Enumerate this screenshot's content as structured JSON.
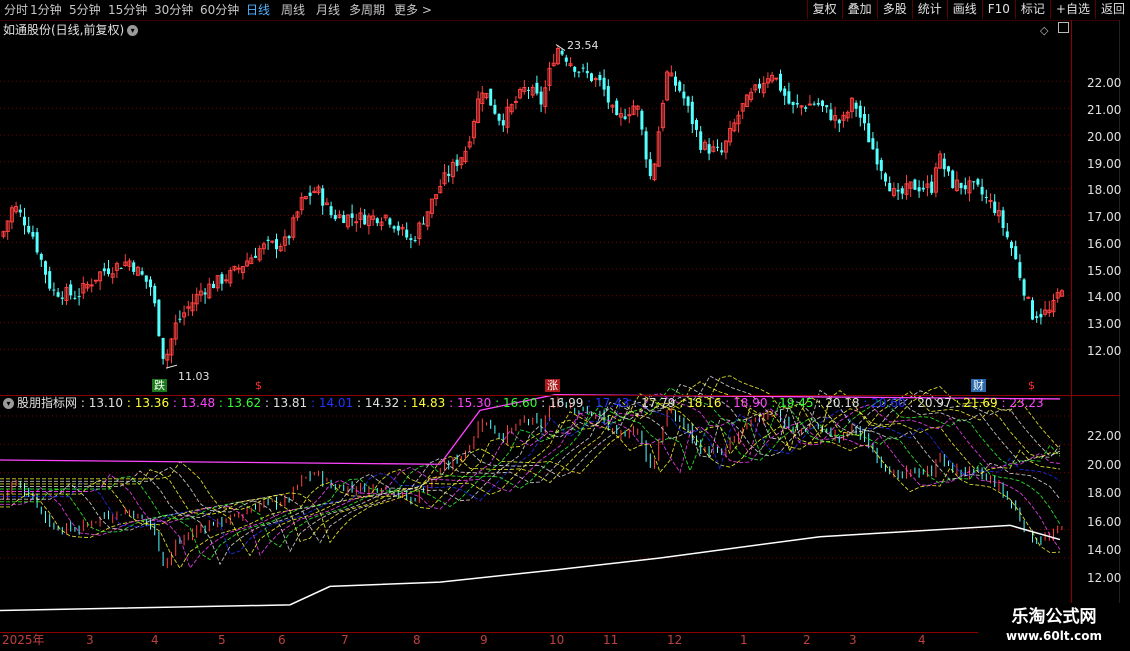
{
  "toolbar": {
    "periods": [
      "分时",
      "1分钟",
      "5分钟",
      "15分钟",
      "30分钟",
      "60分钟",
      "日线",
      "周线",
      "月线",
      "多周期",
      "更多 >"
    ],
    "active_period": "日线",
    "tools": [
      "复权",
      "叠加",
      "多股",
      "统计",
      "画线",
      "F10",
      "标记",
      "+自选",
      "返回"
    ]
  },
  "stock": {
    "title": "如通股份(日线,前复权)",
    "high_label": "23.54",
    "low_label": "11.03"
  },
  "price_axis": [
    "22.00",
    "21.00",
    "20.00",
    "19.00",
    "18.00",
    "17.00",
    "16.00",
    "15.00",
    "14.00",
    "13.00",
    "12.00"
  ],
  "indicator": {
    "name": "股朋指标网",
    "values": [
      {
        "v": "13.10",
        "color": "#e0e0e0"
      },
      {
        "v": "13.36",
        "color": "#ffff33"
      },
      {
        "v": "13.48",
        "color": "#ff44ff"
      },
      {
        "v": "13.62",
        "color": "#33ff33"
      },
      {
        "v": "13.81",
        "color": "#e0e0e0"
      },
      {
        "v": "14.01",
        "color": "#2233ff"
      },
      {
        "v": "14.32",
        "color": "#e0e0e0"
      },
      {
        "v": "14.83",
        "color": "#ffff33"
      },
      {
        "v": "15.30",
        "color": "#ff44ff"
      },
      {
        "v": "16.60",
        "color": "#33ff33"
      },
      {
        "v": "16.99",
        "color": "#e0e0e0"
      },
      {
        "v": "17.43",
        "color": "#2233ff"
      },
      {
        "v": "17.79",
        "color": "#e0e0e0"
      },
      {
        "v": "18.16",
        "color": "#ffff33"
      },
      {
        "v": "18.90",
        "color": "#ff44ff"
      },
      {
        "v": "19.45",
        "color": "#33ff33"
      },
      {
        "v": "20.18",
        "color": "#e0e0e0"
      },
      {
        "v": "20.60",
        "color": "#2233ff"
      },
      {
        "v": "20.97",
        "color": "#e0e0e0"
      },
      {
        "v": "21.69",
        "color": "#ffff33"
      },
      {
        "v": "23.23",
        "color": "#ff44ff"
      }
    ]
  },
  "indicator_axis": [
    "22.00",
    "20.00",
    "18.00",
    "16.00",
    "14.00",
    "12.00"
  ],
  "markers": [
    {
      "text": "跌",
      "bg": "#1a7a1a",
      "color": "#ffffff"
    },
    {
      "text": "$",
      "bg": "transparent",
      "color": "#ff3030"
    },
    {
      "text": "涨",
      "bg": "#aa1a1a",
      "color": "#ffffff"
    },
    {
      "text": "财",
      "bg": "#2a6aaa",
      "color": "#ffffff"
    },
    {
      "text": "$",
      "bg": "transparent",
      "color": "#ff3030"
    }
  ],
  "months": [
    "2025年",
    "3",
    "4",
    "5",
    "6",
    "7",
    "8",
    "9",
    "10",
    "11",
    "12",
    "1",
    "2",
    "3",
    "4"
  ],
  "watermark": {
    "line1": "乐淘公式网",
    "line2": "www.60lt.com"
  },
  "colors": {
    "up": "#ff4040",
    "down": "#54ffff",
    "grid": "#8b0000",
    "bg": "#000000"
  }
}
